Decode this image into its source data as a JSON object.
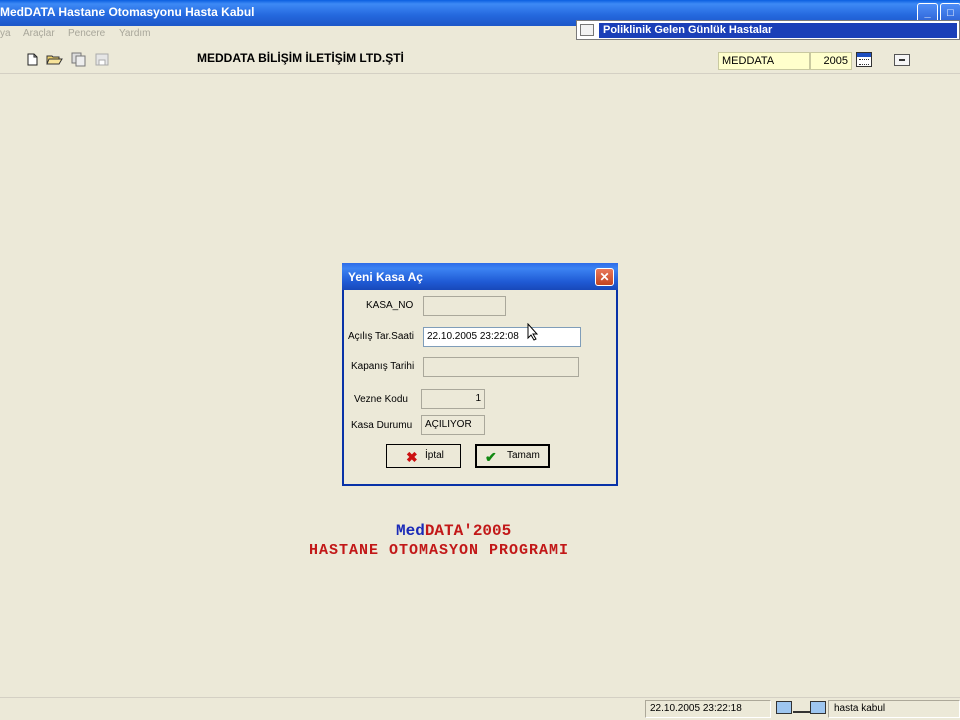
{
  "window": {
    "title": "MedDATA Hastane  Otomasyonu Hasta Kabul",
    "minimize_icon": "minimize-icon",
    "maximize_icon": "maximize-icon"
  },
  "menu": {
    "items": [
      "ya",
      "Araçlar",
      "Pencere",
      "Yardım"
    ]
  },
  "child_window": {
    "title": "Poliklinik Gelen Günlük Hastalar"
  },
  "toolbar": {
    "icons": [
      "new-icon",
      "open-icon",
      "copy-icon",
      "save-icon"
    ],
    "company": "MEDDATA BİLİŞİM İLETİŞİM LTD.ŞTİ",
    "user": "MEDDATA",
    "year": "2005"
  },
  "dialog": {
    "title": "Yeni Kasa Aç",
    "fields": {
      "kasa_no": {
        "label": "KASA_NO",
        "value": ""
      },
      "acilis": {
        "label": "Açılış Tar.Saati",
        "value": "22.10.2005 23:22:08"
      },
      "kapanis": {
        "label": "Kapanış Tarihi",
        "value": ""
      },
      "vezne": {
        "label": "Vezne Kodu",
        "value": "1"
      },
      "durum": {
        "label": "Kasa Durumu",
        "value": "AÇILIYOR"
      }
    },
    "buttons": {
      "cancel": "İptal",
      "ok": "Tamam"
    }
  },
  "branding": {
    "line1_prefix": "Med",
    "line1_rest": "DATA'2005",
    "line2": "HASTANE OTOMASYON PROGRAMI"
  },
  "statusbar": {
    "datetime": "22.10.2005 23:22:18",
    "user": "hasta kabul"
  },
  "colors": {
    "titlebar": "#2467dd",
    "dialog_border": "#0832a8",
    "brand_red": "#c21818",
    "brand_blue": "#1a2ab8",
    "field_yellow": "#ffffcc"
  }
}
